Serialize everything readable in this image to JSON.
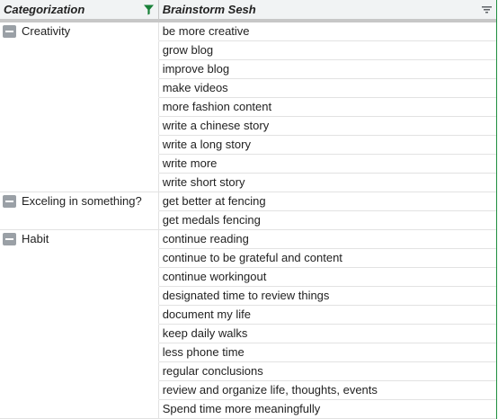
{
  "header": {
    "col1": "Categorization",
    "col2": "Brainstorm Sesh"
  },
  "groups": [
    {
      "label": "Creativity",
      "items": [
        "be more creative",
        "grow blog",
        "improve blog",
        "make videos",
        "more fashion content",
        "write a chinese story",
        "write a long story",
        "write more",
        "write short story"
      ]
    },
    {
      "label": "Exceling in something?",
      "items": [
        "get better at fencing",
        "get medals fencing"
      ]
    },
    {
      "label": "Habit",
      "items": [
        "continue reading",
        "continue to be grateful and content",
        "continue workingout",
        "designated time to review things",
        "document my life",
        "keep daily walks",
        "less phone time",
        "regular conclusions",
        "review and organize life, thoughts, events",
        "Spend time more meaningfully"
      ]
    }
  ],
  "colors": {
    "filter_active": "#188038",
    "header_bg": "#f1f3f4",
    "toggle_bg": "#9aa0a6"
  },
  "icons": {
    "col1_filter": "filter-funnel-icon",
    "col2_filter": "filter-list-icon",
    "group_toggle": "collapse-minus-icon"
  }
}
